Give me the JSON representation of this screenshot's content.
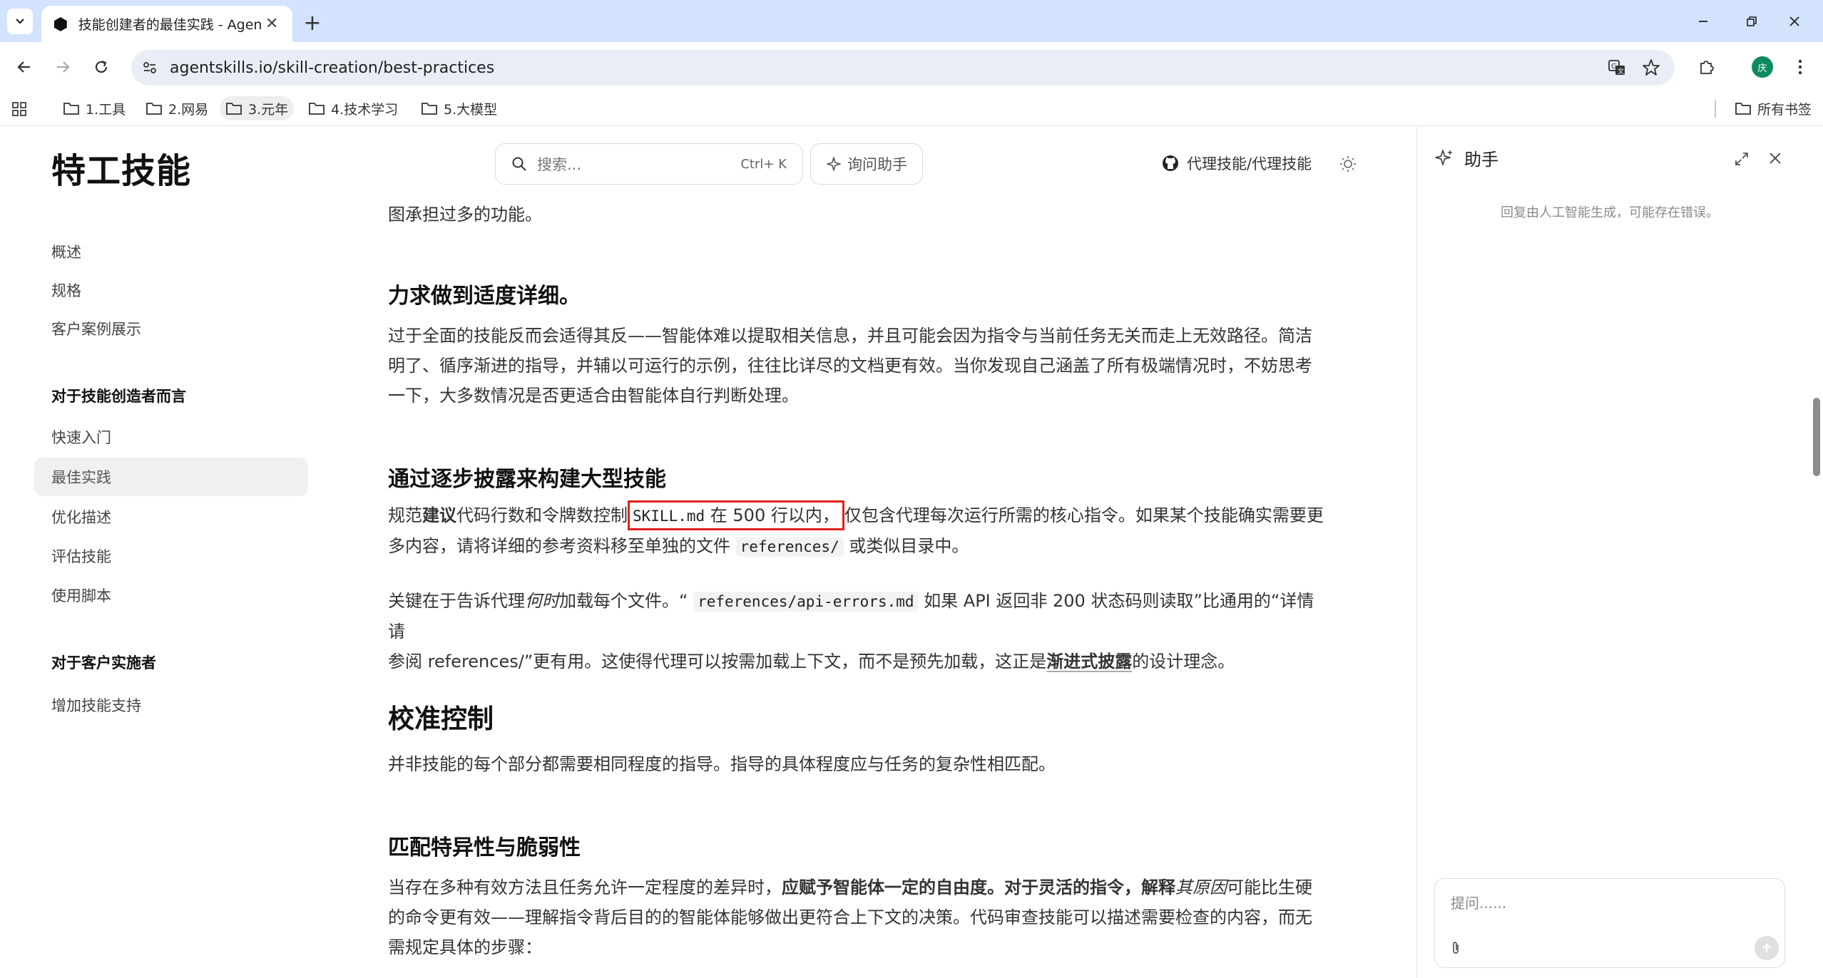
{
  "browser": {
    "tab_title": "技能创建者的最佳实践 - Agent",
    "url": "agentskills.io/skill-creation/best-practices",
    "avatar_text": "庆",
    "bookmarks": [
      "1.工具",
      "2.网易",
      "3.元年",
      "4.技术学习",
      "5.大模型"
    ],
    "all_bookmarks": "所有书签"
  },
  "header": {
    "logo": "特工技能",
    "search_placeholder": "搜索...",
    "search_shortcut": "Ctrl+ K",
    "ask_label": "询问助手",
    "github_label": "代理技能/代理技能"
  },
  "sidebar": {
    "items_top": [
      "概述",
      "规格",
      "客户案例展示"
    ],
    "section_creators": "对于技能创造者而言",
    "items_creators": [
      "快速入门",
      "最佳实践",
      "优化描述",
      "评估技能",
      "使用脚本"
    ],
    "section_clients": "对于客户实施者",
    "items_clients": [
      "增加技能支持"
    ]
  },
  "content": {
    "p0": "图承担过多的功能。",
    "h_detail": "力求做到适度详细。",
    "p1_l1": "过于全面的技能反而会适得其反——智能体难以提取相关信息，并且可能会因为指令与当前任务无关而走上无效路径。简洁",
    "p1_l2": "明了、循序渐进的指导，并辅以可运行的示例，往往比详尽的文档更有效。当你发现自己涵盖了所有极端情况时，不妨思考",
    "p1_l3": "一下，大多数情况是否更适合由智能体自行判断处理。",
    "h_progressive": "通过逐步披露来构建大型技能",
    "p2_a": "规范",
    "p2_bold": "建议",
    "p2_b": "代码行数和令牌数控制",
    "p2_code1": "SKILL.md",
    "p2_c": " 在 500 行以内，",
    "p2_d": "仅包含代理每次运行所需的核心指令。如果某个技能确实需要更",
    "p2_l2a": "多内容，请将详细的参考资料移至单独的文件",
    "p2_code2": "references/",
    "p2_l2b": "或类似目录中。",
    "p3_a": "关键在于告诉代理",
    "p3_italic": "何时",
    "p3_b": "加载每个文件。“",
    "p3_code": "references/api-errors.md",
    "p3_c": "如果 API 返回非 200 状态码则读取”比通用的“详情请",
    "p3_l2a": "参阅 references/”更有用。这使得代理可以按需加载上下文，而不是预先加载，这正是",
    "p3_link": "渐进式披露",
    "p3_l2b": "的设计理念。",
    "h_calibrate": "校准控制",
    "p4": "并非技能的每个部分都需要相同程度的指导。指导的具体程度应与任务的复杂性相匹配。",
    "h_match": "匹配特异性与脆弱性",
    "p5_a": "当存在多种有效方法且任务允许一定程度的差异时，",
    "p5_bold": "应赋予智能体一定的自由度。对于灵活的指令，解释",
    "p5_italic": "其原因",
    "p5_b": "可能比生硬",
    "p5_l2": "的命令更有效——理解指令背后目的的智能体能够做出更符合上下文的决策。代码审查技能可以描述需要检查的内容，而无",
    "p5_l3": "需规定具体的步骤："
  },
  "assistant": {
    "title": "助手",
    "note": "回复由人工智能生成，可能存在错误。",
    "input_placeholder": "提问......"
  }
}
